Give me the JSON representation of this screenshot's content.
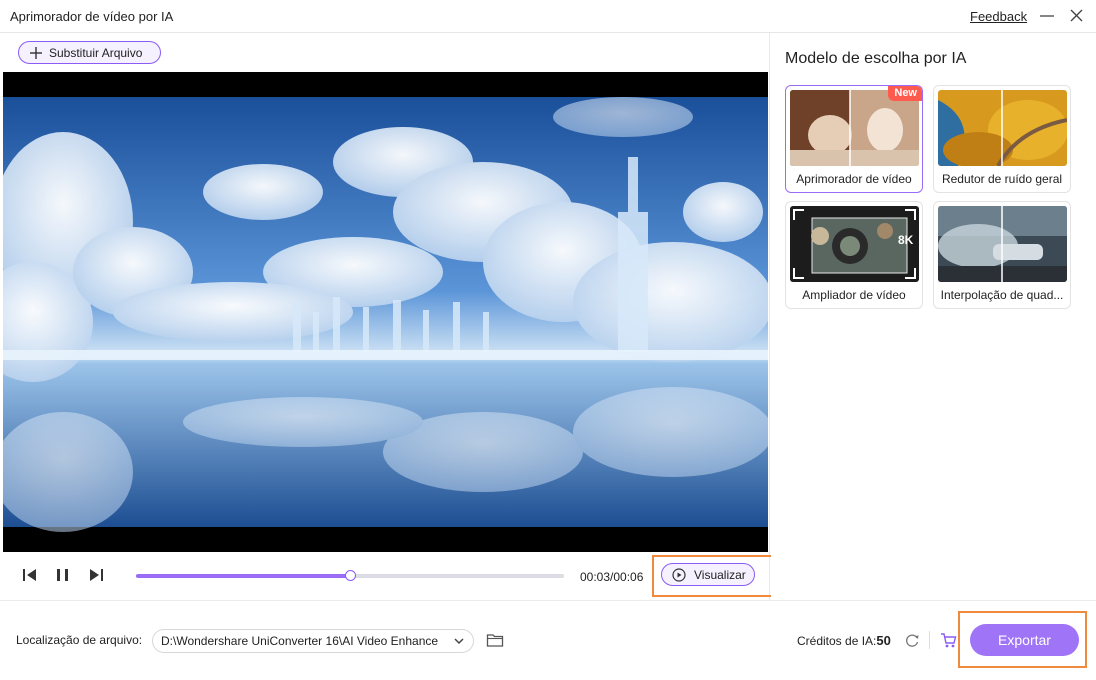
{
  "window": {
    "title": "Aprimorador de vídeo por IA",
    "feedback_label": "Feedback"
  },
  "toolbar": {
    "replace_file_label": "Substituir Arquivo"
  },
  "player": {
    "time_display": "00:03/00:06",
    "progress_fraction": 0.5,
    "preview_label": "Visualizar"
  },
  "model_panel": {
    "heading": "Modelo de escolha por IA",
    "models": [
      {
        "label": "Aprimorador de vídeo",
        "badge": "New",
        "selected": true
      },
      {
        "label": "Redutor de ruído geral",
        "selected": false
      },
      {
        "label": "Ampliador de vídeo",
        "thumb_text": "8K",
        "selected": false
      },
      {
        "label": "Interpolação de quad...",
        "selected": false
      }
    ]
  },
  "bottom": {
    "location_label": "Localização de arquivo:",
    "location_path": "D:\\Wondershare UniConverter 16\\AI Video Enhance",
    "credits_label": "Créditos de IA:",
    "credits_value": "50",
    "export_label": "Exportar"
  },
  "colors": {
    "accent": "#9b6cf7",
    "accent_button": "#9f74f7",
    "highlight_border": "#f08a3c",
    "new_badge": "#ff5a4e"
  }
}
